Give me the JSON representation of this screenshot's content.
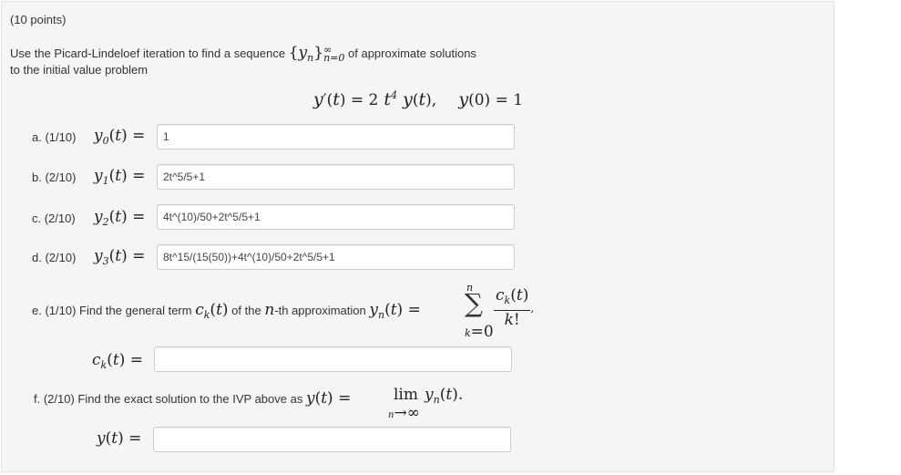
{
  "points": "(10 points)",
  "intro_line1_a": "Use the Picard-Lindeloef iteration to find a sequence",
  "intro_line1_b": "of approximate solutions",
  "intro_line2": "to the initial value problem",
  "parts": [
    {
      "label": "a. (1/10)",
      "fn": "y",
      "idx": "0",
      "value": "1"
    },
    {
      "label": "b. (2/10)",
      "fn": "y",
      "idx": "1",
      "value": "2t^5/5+1"
    },
    {
      "label": "c. (2/10)",
      "fn": "y",
      "idx": "2",
      "value": "4t^(10)/50+2t^5/5+1"
    },
    {
      "label": "d. (2/10)",
      "fn": "y",
      "idx": "3",
      "value": "8t^15/(15(50))+4t^(10)/50+2t^5/5+1"
    }
  ],
  "part_e": {
    "label": "e. (1/10) Find the general term",
    "mid": "of the",
    "mid2": "-th approximation",
    "answer": ""
  },
  "part_f": {
    "label": "f. (2/10) Find the exact solution to the IVP above as",
    "answer": ""
  }
}
